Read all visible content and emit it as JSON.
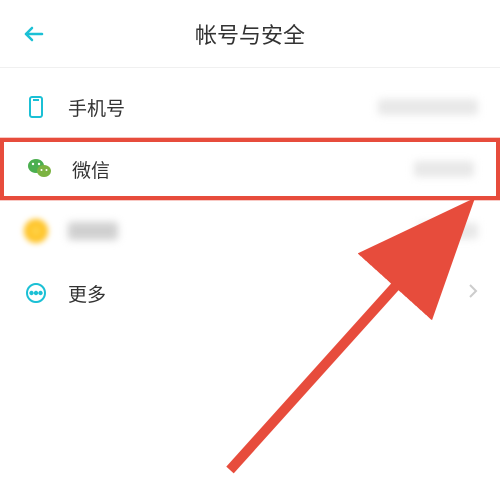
{
  "header": {
    "title": "帐号与安全"
  },
  "items": [
    {
      "label": "手机号"
    },
    {
      "label": "微信"
    },
    {
      "label": ""
    },
    {
      "label": "更多"
    }
  ],
  "icons": {
    "back": "back-arrow-icon",
    "phone": "phone-icon",
    "wechat": "wechat-icon",
    "more": "more-icon",
    "chevron": "chevron-right-icon"
  }
}
